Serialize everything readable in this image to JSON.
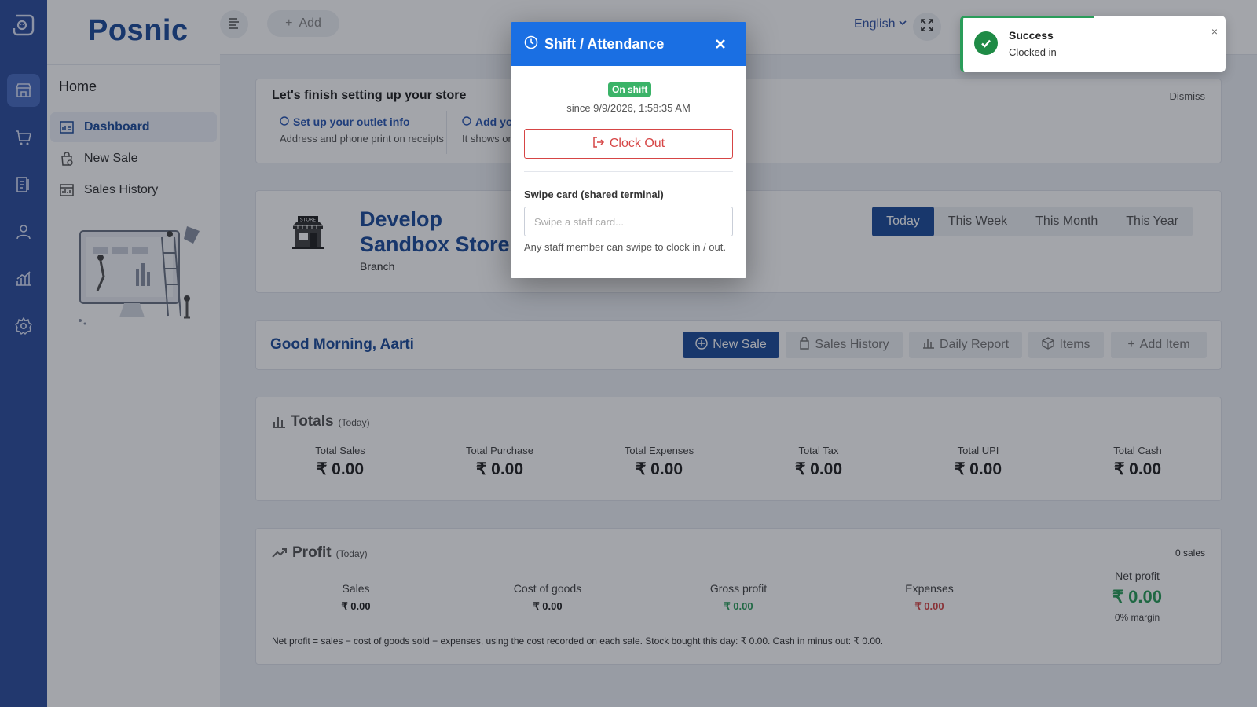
{
  "sidebar": {
    "brand": "Posnic",
    "section": "Home",
    "items": [
      {
        "label": "Dashboard",
        "active": true
      },
      {
        "label": "New Sale"
      },
      {
        "label": "Sales History"
      }
    ]
  },
  "header": {
    "add_label": "Add",
    "language": "English"
  },
  "setup": {
    "title": "Let's finish setting up your store",
    "dismiss": "Dismiss",
    "steps": [
      {
        "title": "Set up your outlet info",
        "desc": "Address and phone print on receipts"
      },
      {
        "title": "Add yo",
        "desc": "It shows on"
      }
    ]
  },
  "store": {
    "name": "Develop Sandbox Store",
    "type": "Branch",
    "periods": [
      "Today",
      "This Week",
      "This Month",
      "This Year"
    ],
    "active_period": "Today"
  },
  "greeting": {
    "text": "Good Morning, Aarti",
    "actions": [
      "New Sale",
      "Sales History",
      "Daily Report",
      "Items",
      "Add Item"
    ]
  },
  "totals": {
    "title": "Totals",
    "subtitle": "(Today)",
    "items": [
      {
        "label": "Total Sales",
        "value": "₹ 0.00"
      },
      {
        "label": "Total Purchase",
        "value": "₹ 0.00"
      },
      {
        "label": "Total Expenses",
        "value": "₹ 0.00"
      },
      {
        "label": "Total Tax",
        "value": "₹ 0.00"
      },
      {
        "label": "Total UPI",
        "value": "₹ 0.00"
      },
      {
        "label": "Total Cash",
        "value": "₹ 0.00"
      }
    ]
  },
  "profit": {
    "title": "Profit",
    "subtitle": "(Today)",
    "sales_count": "0 sales",
    "cols": [
      {
        "label": "Sales",
        "value": "₹ 0.00"
      },
      {
        "label": "Cost of goods",
        "value": "₹ 0.00"
      },
      {
        "label": "Gross profit",
        "value": "₹ 0.00"
      },
      {
        "label": "Expenses",
        "value": "₹ 0.00"
      }
    ],
    "net_label": "Net profit",
    "net_value": "₹ 0.00",
    "margin": "0% margin",
    "formula": "Net profit = sales − cost of goods sold − expenses, using the cost recorded on each sale. Stock bought this day: ₹ 0.00. Cash in minus out: ₹ 0.00."
  },
  "modal": {
    "title": "Shift / Attendance",
    "status": "On shift",
    "since": "since 9/9/2026, 1:58:35 AM",
    "clock_out": "Clock Out",
    "swipe_label": "Swipe card (shared terminal)",
    "swipe_placeholder": "Swipe a staff card...",
    "swipe_help": "Any staff member can swipe to clock in / out."
  },
  "toast": {
    "title": "Success",
    "message": "Clocked in",
    "close": "×",
    "progress": 0.5
  },
  "colors": {
    "rail": "#2f4f9e",
    "brand": "#1f4e9c",
    "modal_header": "#1a6fe3",
    "success": "#2a9d5a",
    "danger": "#d64545"
  }
}
